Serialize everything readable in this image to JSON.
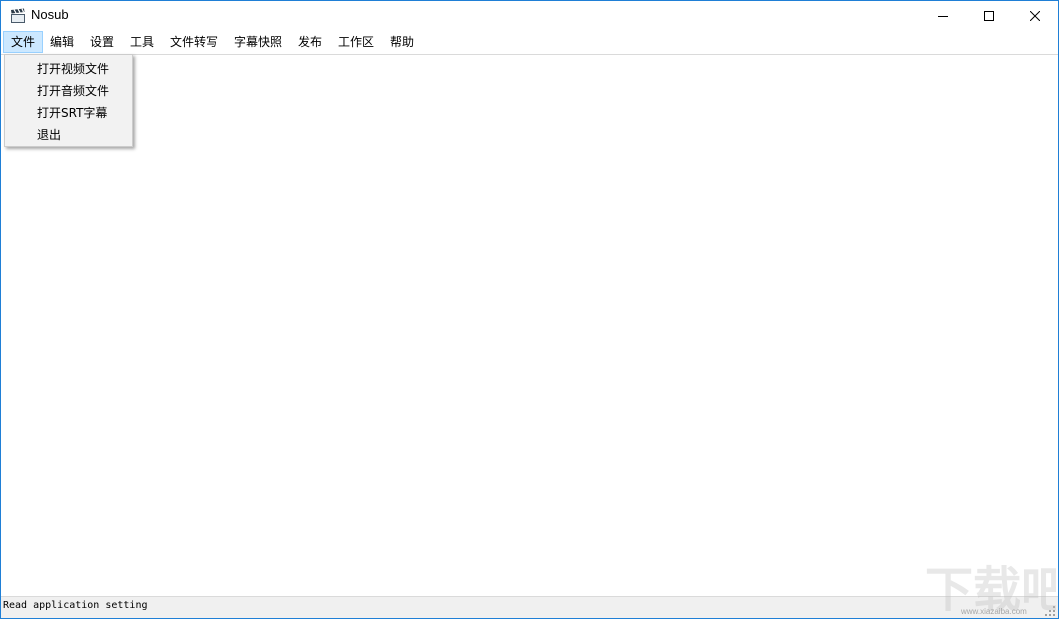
{
  "window": {
    "title": "Nosub",
    "icon": "clapperboard-icon",
    "controls": [
      "minimize-icon",
      "maximize-icon",
      "close-icon"
    ]
  },
  "menubar": {
    "items": [
      {
        "label": "文件",
        "active": true
      },
      {
        "label": "编辑"
      },
      {
        "label": "设置"
      },
      {
        "label": "工具"
      },
      {
        "label": "文件转写"
      },
      {
        "label": "字幕快照"
      },
      {
        "label": "发布"
      },
      {
        "label": "工作区"
      },
      {
        "label": "帮助"
      }
    ]
  },
  "file_menu": {
    "items": [
      {
        "label": "打开视频文件"
      },
      {
        "label": "打开音频文件"
      },
      {
        "label": "打开SRT字幕"
      },
      {
        "label": "退出"
      }
    ]
  },
  "statusbar": {
    "text": "Read application setting"
  },
  "watermark": {
    "text": "下载吧",
    "url": "www.xiazaiba.com"
  },
  "colors": {
    "window_border": "#1f7fd6",
    "menu_active_bg": "#cce8ff",
    "menu_active_border": "#99d1ff",
    "dropdown_bg": "#f2f2f2",
    "statusbar_bg": "#f0f0f0"
  }
}
